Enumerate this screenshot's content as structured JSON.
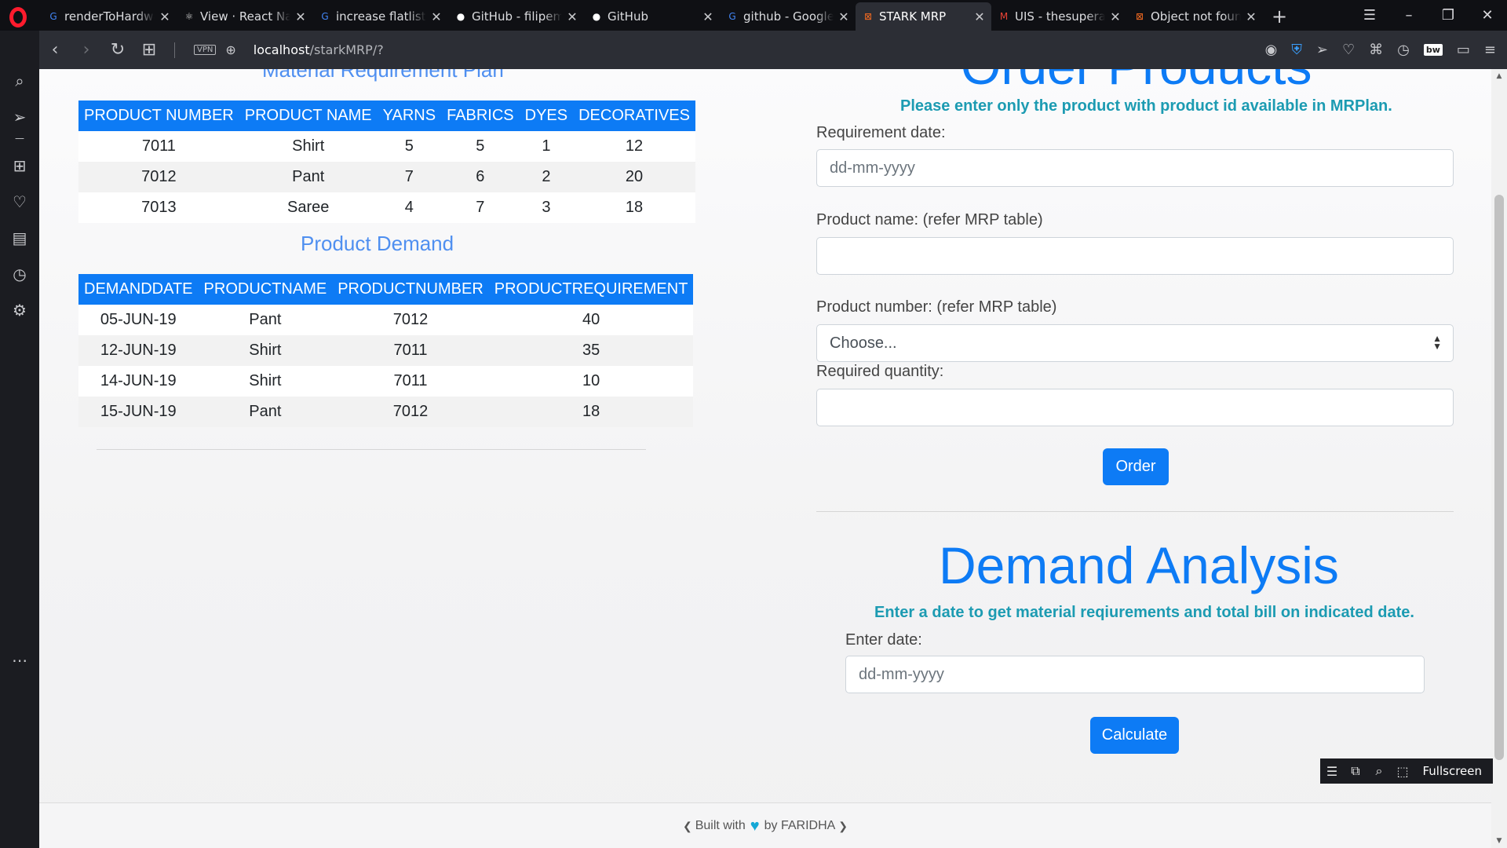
{
  "browser": {
    "tabs": [
      {
        "title": "renderToHardwa",
        "fav": "G",
        "favcolor": "#4285f4"
      },
      {
        "title": "View · React Nat",
        "fav": "⚛",
        "favcolor": "#cfcfcf"
      },
      {
        "title": "increase flatlist p",
        "fav": "G",
        "favcolor": "#4285f4"
      },
      {
        "title": "GitHub - filipem",
        "fav": "●",
        "favcolor": "#ffffff"
      },
      {
        "title": "GitHub",
        "fav": "●",
        "favcolor": "#ffffff"
      },
      {
        "title": "github - Google",
        "fav": "G",
        "favcolor": "#4285f4"
      },
      {
        "title": "STARK MRP",
        "fav": "⊠",
        "favcolor": "#f26a21"
      },
      {
        "title": "UIS - thesuperaz",
        "fav": "M",
        "favcolor": "#ea4335"
      },
      {
        "title": "Object not foun",
        "fav": "⊠",
        "favcolor": "#f26a21"
      }
    ],
    "url_host": "localhost",
    "url_path": "/starkMRP/?",
    "vpn_label": "VPN"
  },
  "mrp": {
    "title": "Material Requirement Plan",
    "headers": [
      "PRODUCT NUMBER",
      "PRODUCT NAME",
      "YARNS",
      "FABRICS",
      "DYES",
      "DECORATIVES"
    ],
    "rows": [
      [
        "7011",
        "Shirt",
        "5",
        "5",
        "1",
        "12"
      ],
      [
        "7012",
        "Pant",
        "7",
        "6",
        "2",
        "20"
      ],
      [
        "7013",
        "Saree",
        "4",
        "7",
        "3",
        "18"
      ]
    ]
  },
  "demand": {
    "title": "Product Demand",
    "headers": [
      "DEMANDDATE",
      "PRODUCTNAME",
      "PRODUCTNUMBER",
      "PRODUCTREQUIREMENT"
    ],
    "rows": [
      [
        "05-JUN-19",
        "Pant",
        "7012",
        "40"
      ],
      [
        "12-JUN-19",
        "Shirt",
        "7011",
        "35"
      ],
      [
        "14-JUN-19",
        "Shirt",
        "7011",
        "10"
      ],
      [
        "15-JUN-19",
        "Pant",
        "7012",
        "18"
      ]
    ]
  },
  "order": {
    "title": "Order Products",
    "subtitle": "Please enter only the product with product id available in MRPlan.",
    "req_date_label": "Requirement date:",
    "req_date_placeholder": "dd-mm-yyyy",
    "product_name_label": "Product name: (refer MRP table)",
    "product_name_value": "",
    "product_number_label": "Product number: (refer MRP table)",
    "product_number_selected": "Choose...",
    "quantity_label": "Required quantity:",
    "quantity_value": "",
    "order_button": "Order"
  },
  "analysis": {
    "title": "Demand Analysis",
    "subtitle": "Enter a date to get material reqiurements and total bill on indicated date.",
    "date_label": "Enter date:",
    "date_placeholder": "dd-mm-yyyy",
    "calculate_button": "Calculate"
  },
  "footer": {
    "built_with": "Built with",
    "by": "by FARIDHA"
  },
  "video_popout": {
    "fullscreen_label": "Fullscreen"
  },
  "colors": {
    "primary": "#0d7bf5",
    "subtitle": "#1c9bb2",
    "heart": "#15a8d6"
  }
}
